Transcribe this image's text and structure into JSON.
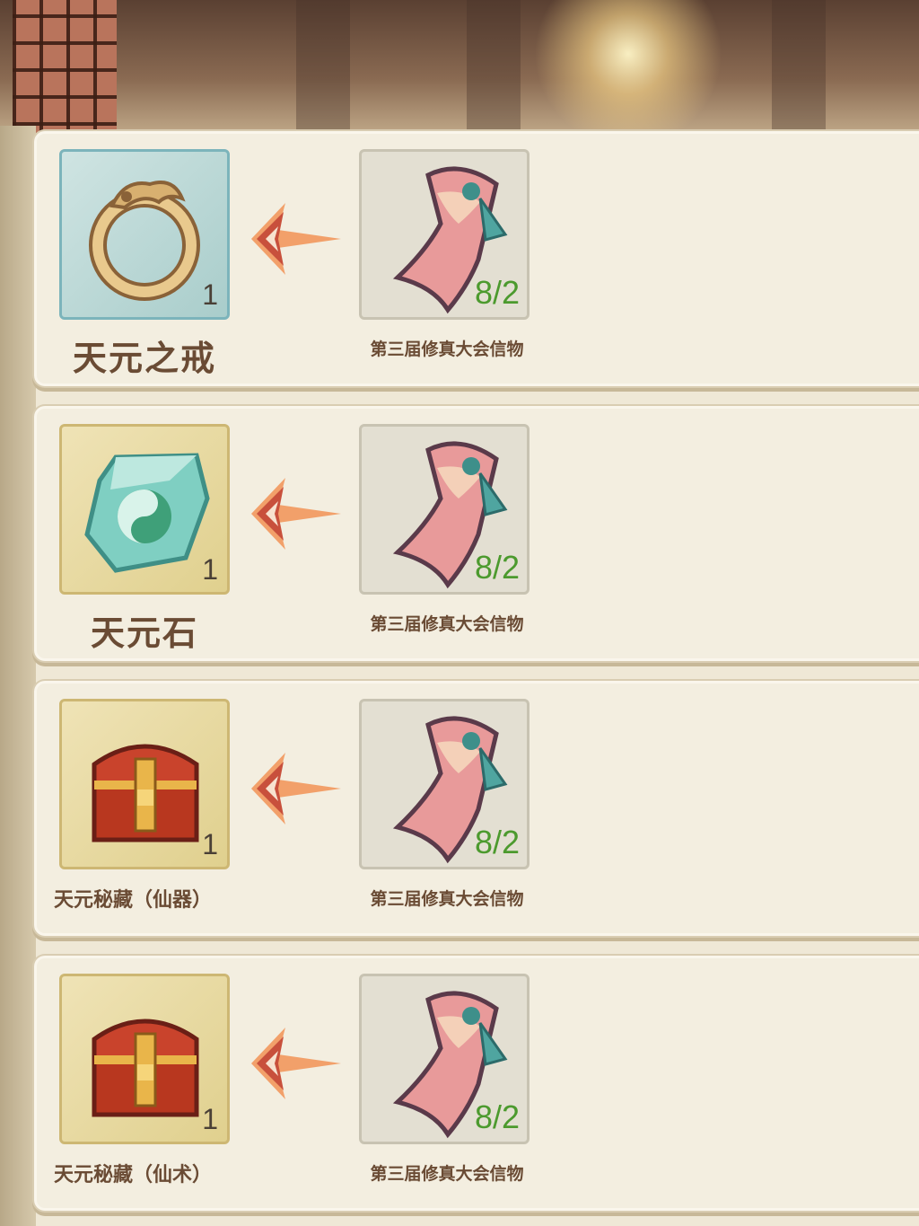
{
  "recipes": [
    {
      "reward_name": "天元之戒",
      "reward_count": "1",
      "reward_icon": "dragon-ring-icon",
      "slot_style": "cyan",
      "cost_name": "第三届修真大会信物",
      "cost_progress": "8/2",
      "cost_icon": "token-scroll-icon"
    },
    {
      "reward_name": "天元石",
      "reward_count": "1",
      "reward_icon": "jade-stone-icon",
      "slot_style": "gold",
      "cost_name": "第三届修真大会信物",
      "cost_progress": "8/2",
      "cost_icon": "token-scroll-icon"
    },
    {
      "reward_name": "天元秘藏（仙器）",
      "reward_count": "1",
      "reward_icon": "treasure-chest-icon",
      "slot_style": "gold",
      "cost_name": "第三届修真大会信物",
      "cost_progress": "8/2",
      "cost_icon": "token-scroll-icon"
    },
    {
      "reward_name": "天元秘藏（仙术）",
      "reward_count": "1",
      "reward_icon": "treasure-chest-icon",
      "slot_style": "gold",
      "cost_name": "第三届修真大会信物",
      "cost_progress": "8/2",
      "cost_icon": "token-scroll-icon"
    }
  ],
  "colors": {
    "progress_green": "#4c9a2e",
    "label_brown": "#6a4b34",
    "arrow_red": "#c8503c"
  }
}
